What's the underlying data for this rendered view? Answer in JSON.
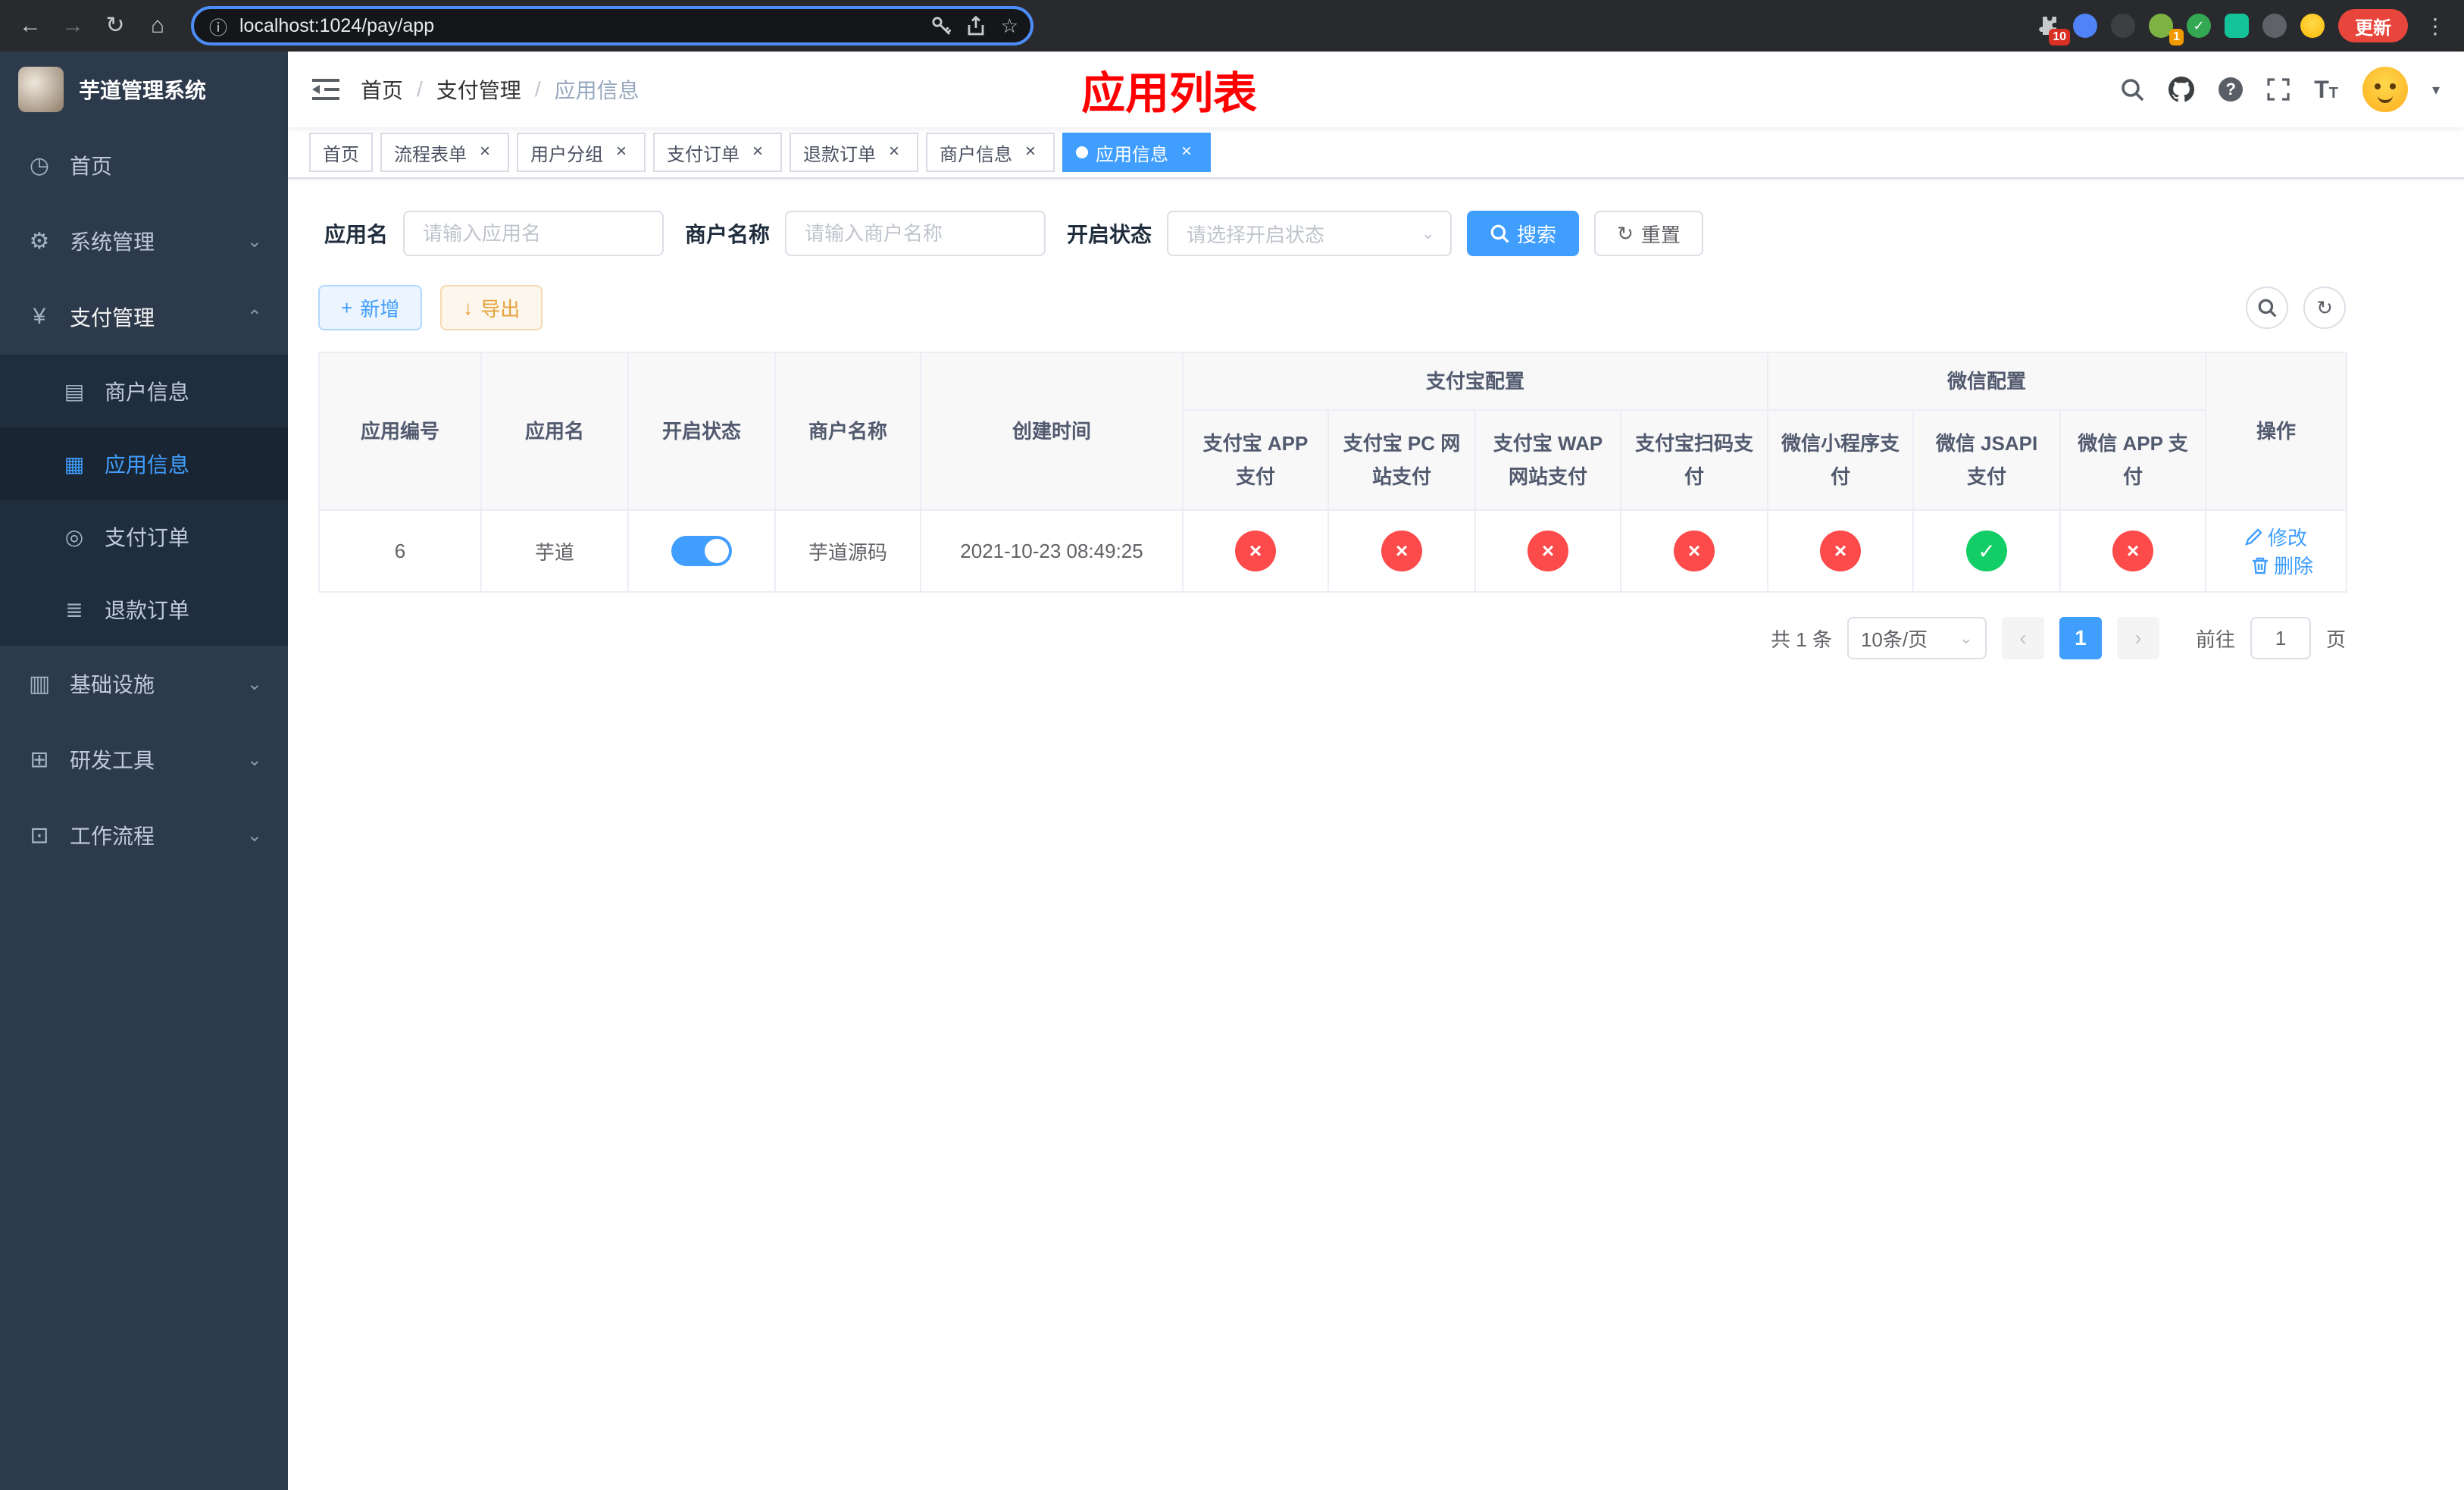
{
  "browser": {
    "url": "localhost:1024/pay/app",
    "update_button": "更新",
    "extensions_badge": "10",
    "profile_badge": "1"
  },
  "sidebar": {
    "title": "芋道管理系统",
    "home": "首页",
    "system": "系统管理",
    "payment": "支付管理",
    "merchant_info": "商户信息",
    "app_info": "应用信息",
    "pay_order": "支付订单",
    "refund_order": "退款订单",
    "infra": "基础设施",
    "dev_tools": "研发工具",
    "workflow": "工作流程"
  },
  "breadcrumb": {
    "home": "首页",
    "separator": "/",
    "section": "支付管理",
    "current": "应用信息"
  },
  "annotation": "应用列表",
  "tabs": [
    {
      "label": "首页",
      "closable": false,
      "active": false
    },
    {
      "label": "流程表单",
      "closable": true,
      "active": false
    },
    {
      "label": "用户分组",
      "closable": true,
      "active": false
    },
    {
      "label": "支付订单",
      "closable": true,
      "active": false
    },
    {
      "label": "退款订单",
      "closable": true,
      "active": false
    },
    {
      "label": "商户信息",
      "closable": true,
      "active": false
    },
    {
      "label": "应用信息",
      "closable": true,
      "active": true
    }
  ],
  "filters": {
    "app_name_label": "应用名",
    "app_name_placeholder": "请输入应用名",
    "merchant_label": "商户名称",
    "merchant_placeholder": "请输入商户名称",
    "status_label": "开启状态",
    "status_placeholder": "请选择开启状态",
    "search_button": "搜索",
    "reset_button": "重置"
  },
  "toolbar": {
    "add_button": "新增",
    "export_button": "导出"
  },
  "table": {
    "headers": {
      "id": "应用编号",
      "name": "应用名",
      "enabled": "开启状态",
      "merchant": "商户名称",
      "created": "创建时间",
      "alipay_group": "支付宝配置",
      "wechat_group": "微信配置",
      "alipay_app": "支付宝 APP 支付",
      "alipay_pc": "支付宝 PC 网站支付",
      "alipay_wap": "支付宝 WAP 网站支付",
      "alipay_qr": "支付宝扫码支付",
      "wechat_mini": "微信小程序支付",
      "wechat_jsapi": "微信 JSAPI 支付",
      "wechat_app": "微信 APP 支付",
      "actions": "操作"
    },
    "row": {
      "id": "6",
      "name": "芋道",
      "enabled": true,
      "merchant": "芋道源码",
      "created": "2021-10-23 08:49:25",
      "alipay_app": false,
      "alipay_pc": false,
      "alipay_wap": false,
      "alipay_qr": false,
      "wechat_mini": false,
      "wechat_jsapi": true,
      "wechat_app": false,
      "edit_action": "修改",
      "delete_action": "删除"
    }
  },
  "pagination": {
    "total": "共 1 条",
    "page_size": "10条/页",
    "page": "1",
    "goto_label": "前往",
    "goto_value": "1",
    "goto_unit": "页"
  },
  "colors": {
    "primary": "#409eff",
    "success": "#13ce66",
    "danger": "#fd4b4b",
    "annotation": "#ff0000",
    "sidebar_bg": "#2d3a4b"
  },
  "icons": {
    "back": "←",
    "forward": "→",
    "reload": "↻",
    "home": "⌂",
    "info": "ⓘ",
    "star": "☆",
    "kebab": "⋮",
    "dashboard": "◷",
    "gear": "⚙",
    "yen": "¥",
    "card": "▤",
    "grid": "▦",
    "order": "◎",
    "doc": "≣",
    "infra": "▥",
    "tools": "⊞",
    "flow": "⊡",
    "chevron_down": "⌄",
    "chevron_up": "⌃",
    "caret_down": "▾",
    "plus": "+",
    "download": "↓",
    "refresh": "↻",
    "check": "✓",
    "cross": "×",
    "prev": "‹",
    "next": "›",
    "question": "?",
    "text_icon_large": "T",
    "text_icon_small": "T"
  }
}
